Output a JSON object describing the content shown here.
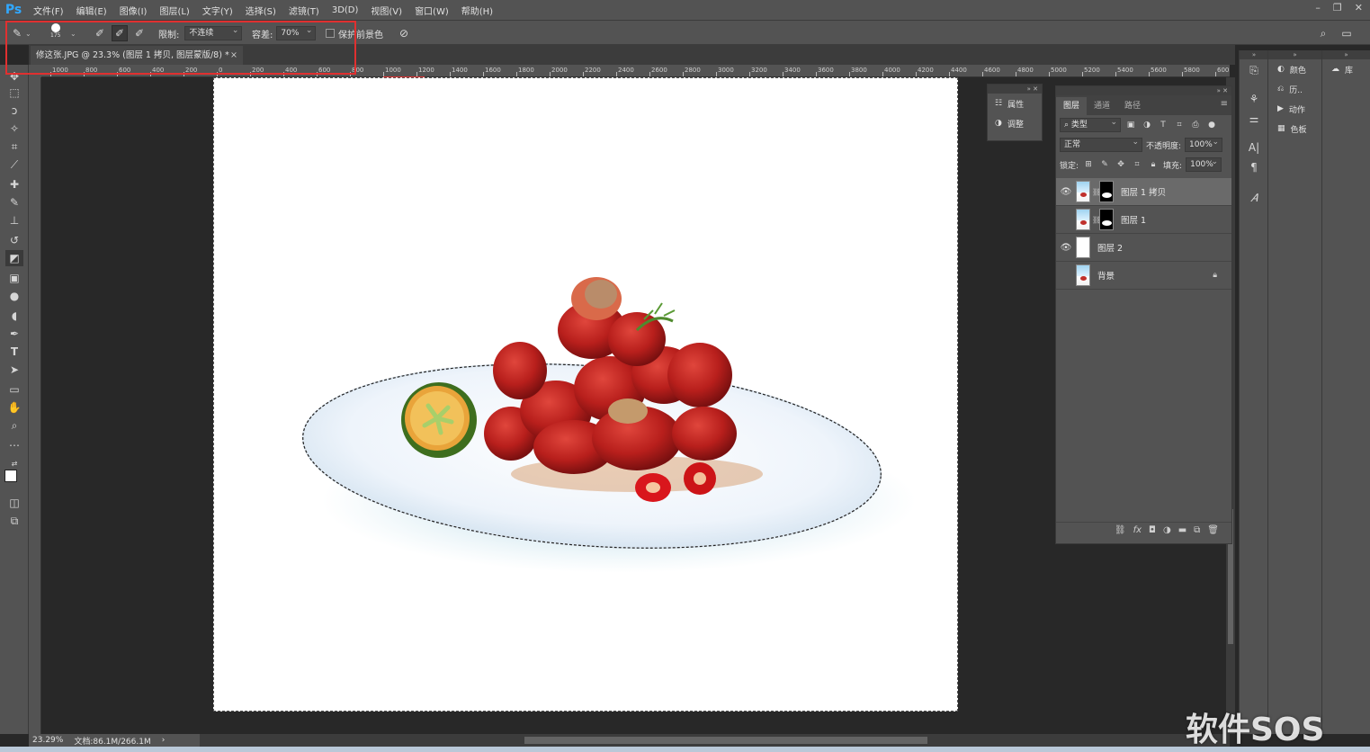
{
  "app": {
    "logo": "Ps"
  },
  "menu": [
    "文件(F)",
    "编辑(E)",
    "图像(I)",
    "图层(L)",
    "文字(Y)",
    "选择(S)",
    "滤镜(T)",
    "3D(D)",
    "视图(V)",
    "窗口(W)",
    "帮助(H)"
  ],
  "window_controls": {
    "minimize": "–",
    "restore": "❐",
    "close": "✕"
  },
  "options": {
    "brush_size": "175",
    "limit_label": "限制:",
    "limit_value": "不连续",
    "tolerance_label": "容差:",
    "tolerance_value": "70%",
    "protect_label": "保护前景色"
  },
  "document": {
    "tab_title": "修这张.JPG @ 23.3% (图层 1 拷贝, 图层蒙版/8) *",
    "close": "×"
  },
  "ruler": {
    "labels": [
      "1000",
      "800",
      "600",
      "400",
      "200",
      "0",
      "200",
      "400",
      "600",
      "800",
      "1000",
      "1200",
      "1400",
      "1600",
      "1800",
      "2000",
      "2200",
      "2400",
      "2600",
      "2800",
      "3000",
      "3200",
      "3400",
      "3600",
      "3800",
      "4000",
      "4200",
      "4400",
      "4600",
      "4800",
      "5000",
      "5200",
      "5400",
      "5600",
      "5800",
      "600"
    ]
  },
  "status": {
    "zoom": "23.29%",
    "doc_size": "文档:86.1M/266.1M",
    "arrow": "›"
  },
  "mini_panel": {
    "items": [
      {
        "label": "属性",
        "icon": "properties-icon"
      },
      {
        "label": "调整",
        "icon": "adjustments-icon"
      }
    ]
  },
  "layers": {
    "tabs": [
      "图层",
      "通道",
      "路径"
    ],
    "filter_label": "类型",
    "blend_mode": "正常",
    "opacity_label": "不透明度:",
    "opacity_value": "100%",
    "lock_label": "锁定:",
    "fill_label": "填充:",
    "fill_value": "100%",
    "items": [
      {
        "name": "图层 1 拷贝",
        "visible": true,
        "selected": true,
        "mask": true
      },
      {
        "name": "图层 1",
        "visible": false,
        "selected": false,
        "mask": true
      },
      {
        "name": "图层 2",
        "visible": true,
        "selected": false,
        "mask": false
      },
      {
        "name": "背景",
        "visible": false,
        "selected": false,
        "mask": false,
        "locked": true
      }
    ]
  },
  "right_panel": {
    "items": [
      {
        "label": "颜色",
        "icon": "color-icon"
      },
      {
        "label": "历..",
        "icon": "history-icon"
      },
      {
        "label": "动作",
        "icon": "actions-icon"
      },
      {
        "label": "色板",
        "icon": "swatches-icon"
      }
    ],
    "library_label": "库"
  },
  "watermark": "软件SOS"
}
